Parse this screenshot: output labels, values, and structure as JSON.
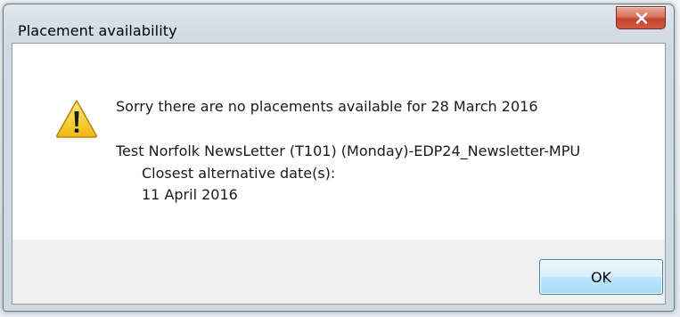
{
  "window": {
    "title": "Placement availability",
    "close_icon": "close-icon"
  },
  "message": {
    "icon": "warning-icon",
    "main": "Sorry there are no placements available for 28 March 2016",
    "product": "Test Norfolk NewsLetter (T101) (Monday)-EDP24_Newsletter-MPU",
    "alternative_label": "Closest alternative date(s):",
    "alternative_dates": [
      "11 April 2016"
    ]
  },
  "buttons": {
    "ok_label": "OK"
  },
  "colors": {
    "close_button": "#c4432b",
    "ok_button_border": "#3c7fb1",
    "warning_fill": "#f3c623"
  }
}
